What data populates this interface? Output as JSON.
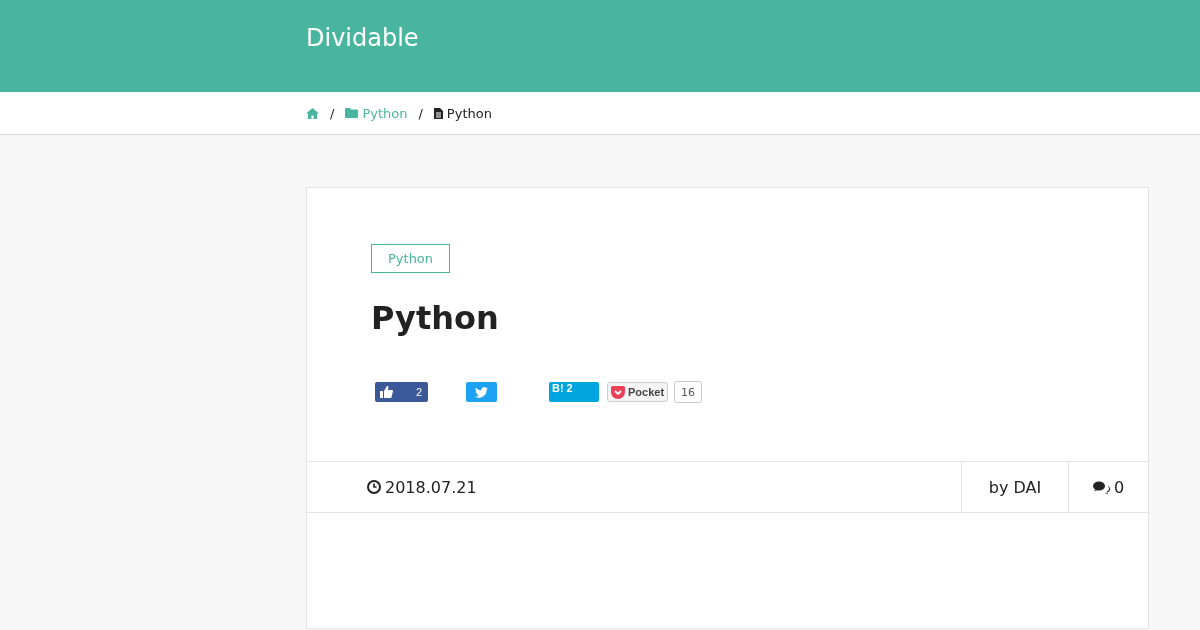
{
  "site": {
    "title": "Dividable"
  },
  "breadcrumb": [
    {
      "kind": "home"
    },
    {
      "kind": "folder",
      "label": "Python"
    },
    {
      "kind": "page",
      "label": "Python"
    }
  ],
  "breadcrumb_separator": "/",
  "article": {
    "category": "Python",
    "title": "Python",
    "share": [
      {
        "kind": "like",
        "count": "2"
      },
      {
        "kind": "tweet"
      },
      {
        "kind": "hatena",
        "label": "B!",
        "count": "2"
      },
      {
        "kind": "pocket",
        "label": "Pocket",
        "count": "16"
      }
    ],
    "date": "2018.07.21",
    "author": "by DAI",
    "comments": "0"
  }
}
